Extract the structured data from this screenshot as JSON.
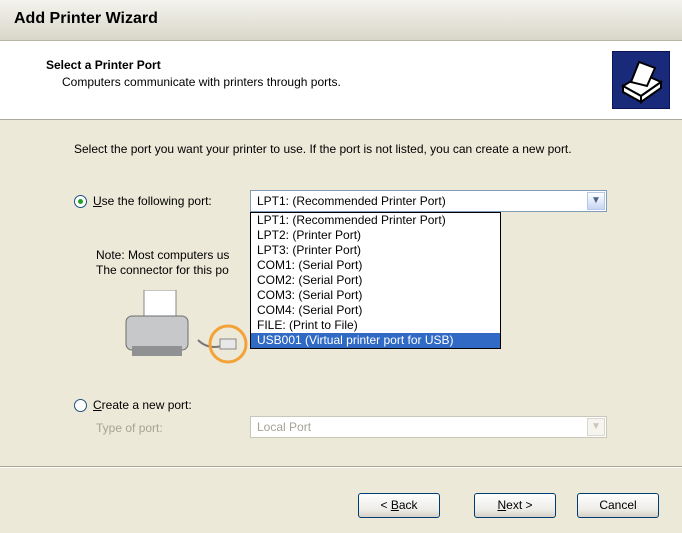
{
  "window": {
    "title": "Add Printer Wizard"
  },
  "header": {
    "title": "Select a Printer Port",
    "subtitle": "Computers communicate with printers through ports."
  },
  "main": {
    "intro": "Select the port you want your printer to use.  If the port is not listed, you can create a new port.",
    "use_port": {
      "label_prefix": "",
      "label_mnemonic": "U",
      "label_rest": "se the following port:",
      "selected_value": "LPT1: (Recommended Printer Port)"
    },
    "dropdown_options": [
      "LPT1: (Recommended Printer Port)",
      "LPT2: (Printer Port)",
      "LPT3: (Printer Port)",
      "COM1: (Serial Port)",
      "COM2: (Serial Port)",
      "COM3: (Serial Port)",
      "COM4: (Serial Port)",
      "FILE: (Print to File)",
      "USB001 (Virtual printer port for USB)"
    ],
    "note_line1": "Note: Most computers us",
    "note_line2": "The connector for this po",
    "create_port": {
      "label_mnemonic": "C",
      "label_rest": "reate a new port:",
      "type_label": "Type of port:",
      "type_value": "Local Port"
    }
  },
  "footer": {
    "back": {
      "prefix": "< ",
      "mnemonic": "B",
      "rest": "ack"
    },
    "next": {
      "mnemonic": "N",
      "rest": "ext >"
    },
    "cancel": "Cancel"
  },
  "icons": {
    "header_icon": "printer-wizard-icon",
    "dropdown_arrow": "chevron-down-icon",
    "illustration": "printer-illustration-icon"
  }
}
